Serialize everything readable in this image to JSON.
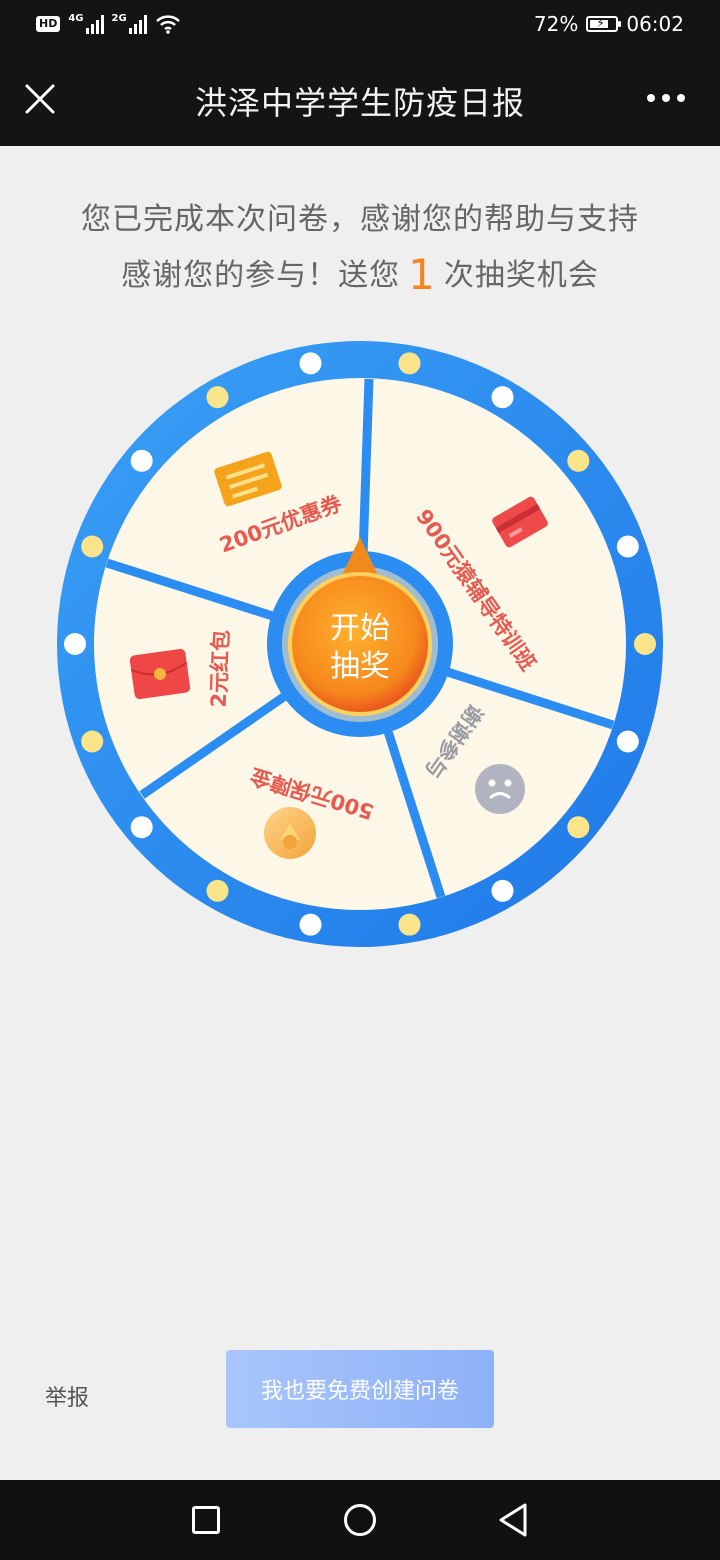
{
  "status_bar": {
    "hd": "HD",
    "sim1_label": "4G",
    "sim2_label": "2G",
    "battery_percent": "72%",
    "battery_level": 0.72,
    "time": "06:02"
  },
  "nav": {
    "title": "洪泽中学学生防疫日报",
    "close_icon": "close-icon",
    "more_icon": "more-dots-icon"
  },
  "message": {
    "line1": "您已完成本次问卷，感谢您的帮助与支持",
    "line2_prefix": "感谢您的参与！送您",
    "chance_count": "1",
    "line2_suffix": "次抽奖机会"
  },
  "wheel": {
    "start_label_line1": "开始",
    "start_label_line2": "抽奖",
    "colors": {
      "ring": "#2b8cf2",
      "segment": "#fdf7e8",
      "center": "#f08a1c",
      "prize_text": "#e85a4f"
    },
    "prizes": [
      {
        "label": "900元猿辅导特训班",
        "icon": "bank-card-icon"
      },
      {
        "label": "谢谢参与",
        "icon": "smiley-icon"
      },
      {
        "label": "500元保障金",
        "icon": "gold-coin-icon"
      },
      {
        "label": "2元红包",
        "icon": "red-envelope-icon"
      },
      {
        "label": "200元优惠券",
        "icon": "coupon-icon"
      }
    ]
  },
  "footer": {
    "report": "举报",
    "create_button": "我也要免费创建问卷"
  }
}
